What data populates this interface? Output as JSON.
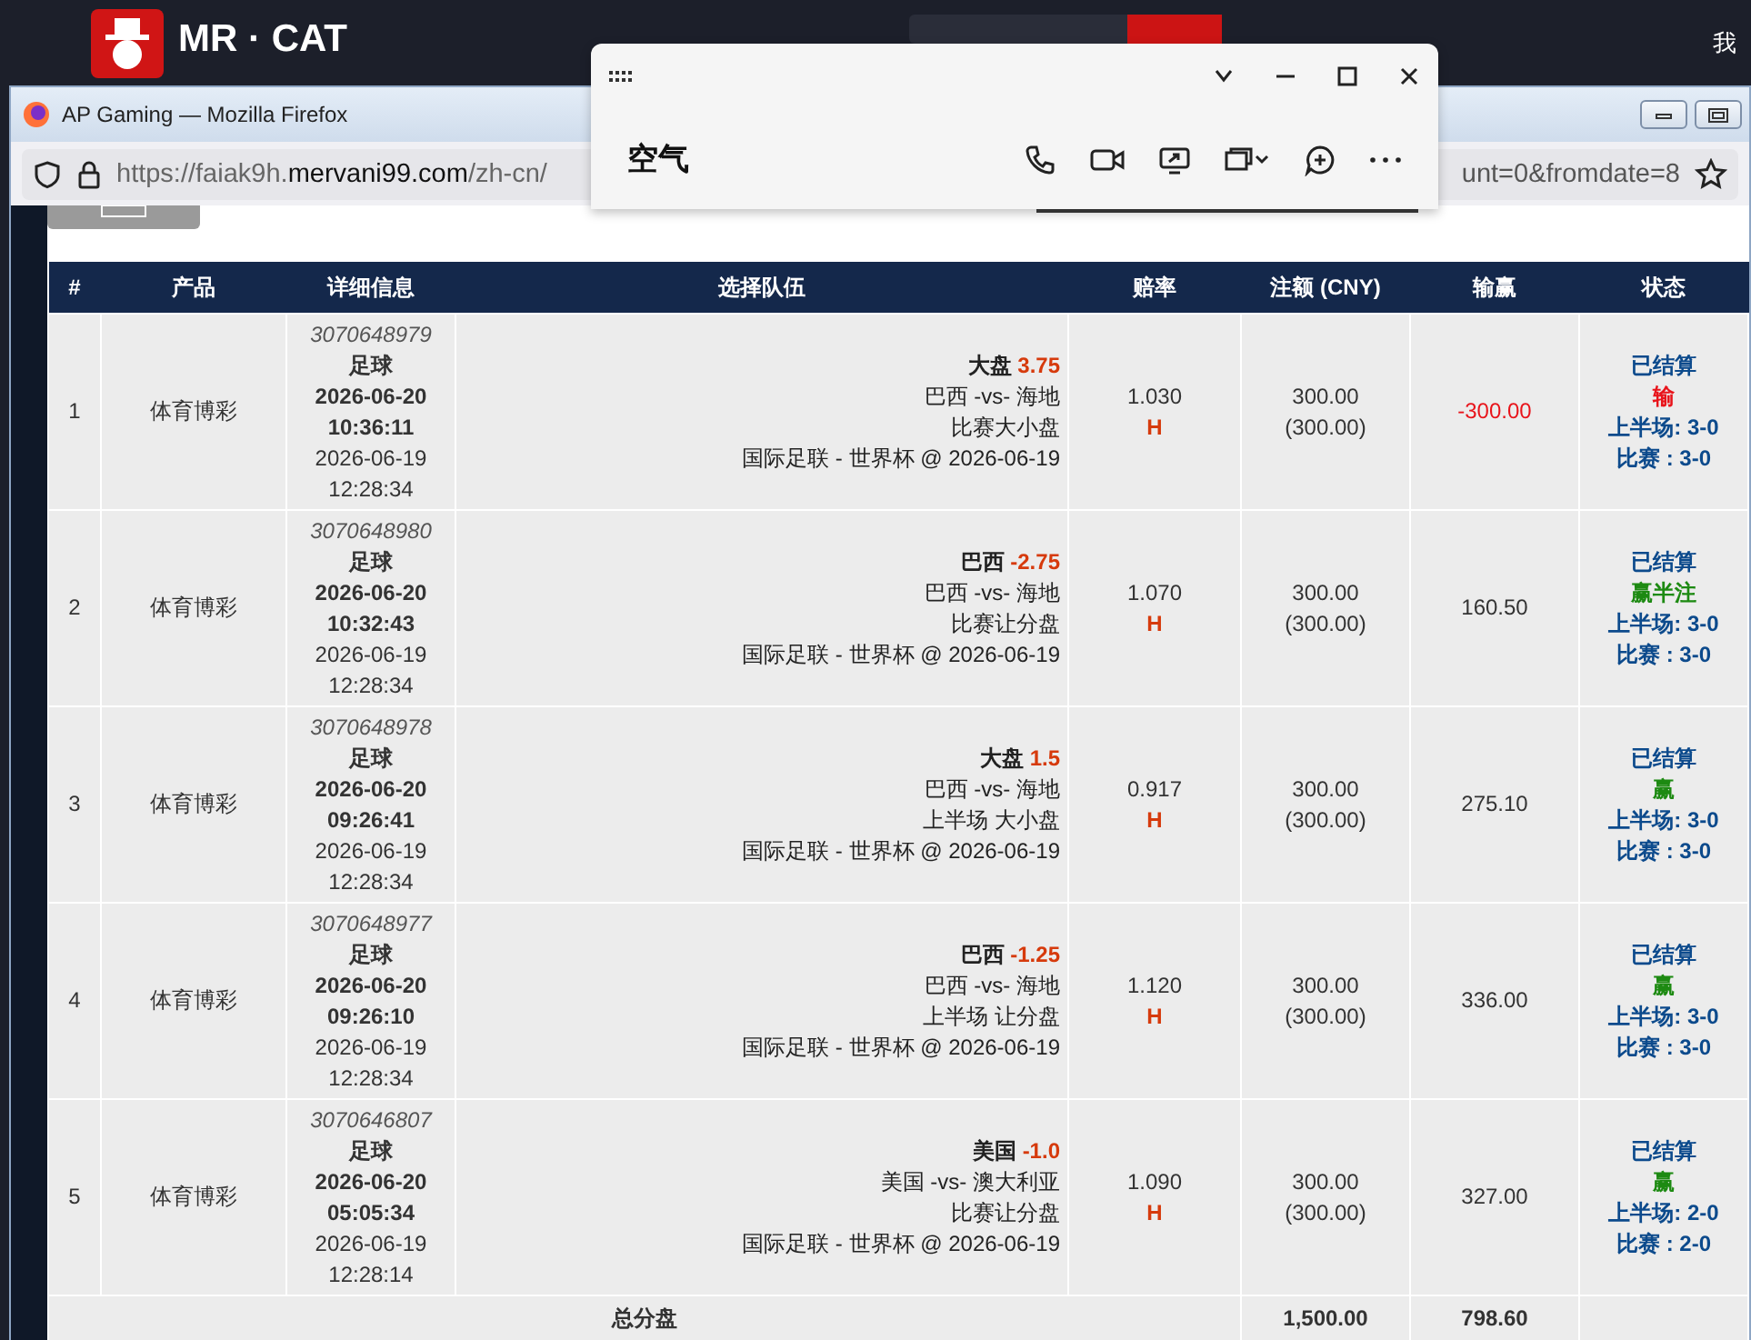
{
  "top_bar": {
    "logo_text": "MR · CAT",
    "user_menu": "我"
  },
  "browser": {
    "title": "AP Gaming — Mozilla Firefox",
    "url_start": "https://faiak9h.",
    "url_domain": "mervani99.com",
    "url_path": "/zh-cn/",
    "url_tail": "unt=0&fromdate=8"
  },
  "chat_window": {
    "contact": "空气"
  },
  "table": {
    "columns": [
      "#",
      "产品",
      "详细信息",
      "选择队伍",
      "赔率",
      "注额 (CNY)",
      "输赢",
      "状态"
    ],
    "rows": [
      {
        "no": "1",
        "product": "体育博彩",
        "ticket": "3070648979",
        "sport": "足球",
        "bet_date": "2026-06-20",
        "bet_time": "10:36:11",
        "match_date": "2026-06-19",
        "match_time": "12:28:34",
        "pick": "大盘",
        "line": "3.75",
        "match": "巴西 -vs- 海地",
        "market": "比赛大小盘",
        "league": "国际足联 - 世界杯 @ 2026-06-19",
        "odds": "1.030",
        "odds_type": "H",
        "stake": "300.00",
        "stake_actual": "(300.00)",
        "win_loss": "-300.00",
        "lost": true,
        "status": "已结算",
        "result": "输",
        "half_score": "上半场: 3-0",
        "full_score": "比赛 : 3-0"
      },
      {
        "no": "2",
        "product": "体育博彩",
        "ticket": "3070648980",
        "sport": "足球",
        "bet_date": "2026-06-20",
        "bet_time": "10:32:43",
        "match_date": "2026-06-19",
        "match_time": "12:28:34",
        "pick": "巴西",
        "line": "-2.75",
        "match": "巴西 -vs- 海地",
        "market": "比赛让分盘",
        "league": "国际足联 - 世界杯 @ 2026-06-19",
        "odds": "1.070",
        "odds_type": "H",
        "stake": "300.00",
        "stake_actual": "(300.00)",
        "win_loss": "160.50",
        "lost": false,
        "status": "已结算",
        "result": "赢半注",
        "half_score": "上半场: 3-0",
        "full_score": "比赛 : 3-0"
      },
      {
        "no": "3",
        "product": "体育博彩",
        "ticket": "3070648978",
        "sport": "足球",
        "bet_date": "2026-06-20",
        "bet_time": "09:26:41",
        "match_date": "2026-06-19",
        "match_time": "12:28:34",
        "pick": "大盘",
        "line": "1.5",
        "match": "巴西 -vs- 海地",
        "market": "上半场 大小盘",
        "league": "国际足联 - 世界杯 @ 2026-06-19",
        "odds": "0.917",
        "odds_type": "H",
        "stake": "300.00",
        "stake_actual": "(300.00)",
        "win_loss": "275.10",
        "lost": false,
        "status": "已结算",
        "result": "赢",
        "half_score": "上半场: 3-0",
        "full_score": "比赛 : 3-0"
      },
      {
        "no": "4",
        "product": "体育博彩",
        "ticket": "3070648977",
        "sport": "足球",
        "bet_date": "2026-06-20",
        "bet_time": "09:26:10",
        "match_date": "2026-06-19",
        "match_time": "12:28:34",
        "pick": "巴西",
        "line": "-1.25",
        "match": "巴西 -vs- 海地",
        "market": "上半场 让分盘",
        "league": "国际足联 - 世界杯 @ 2026-06-19",
        "odds": "1.120",
        "odds_type": "H",
        "stake": "300.00",
        "stake_actual": "(300.00)",
        "win_loss": "336.00",
        "lost": false,
        "status": "已结算",
        "result": "赢",
        "half_score": "上半场: 3-0",
        "full_score": "比赛 : 3-0"
      },
      {
        "no": "5",
        "product": "体育博彩",
        "ticket": "3070646807",
        "sport": "足球",
        "bet_date": "2026-06-20",
        "bet_time": "05:05:34",
        "match_date": "2026-06-19",
        "match_time": "12:28:14",
        "pick": "美国",
        "line": "-1.0",
        "match": "美国 -vs- 澳大利亚",
        "market": "比赛让分盘",
        "league": "国际足联 - 世界杯 @ 2026-06-19",
        "odds": "1.090",
        "odds_type": "H",
        "stake": "300.00",
        "stake_actual": "(300.00)",
        "win_loss": "327.00",
        "lost": false,
        "status": "已结算",
        "result": "赢",
        "half_score": "上半场: 2-0",
        "full_score": "比赛 : 2-0"
      }
    ],
    "total": {
      "label": "总分盘",
      "stake": "1,500.00",
      "win_loss": "798.60"
    }
  }
}
